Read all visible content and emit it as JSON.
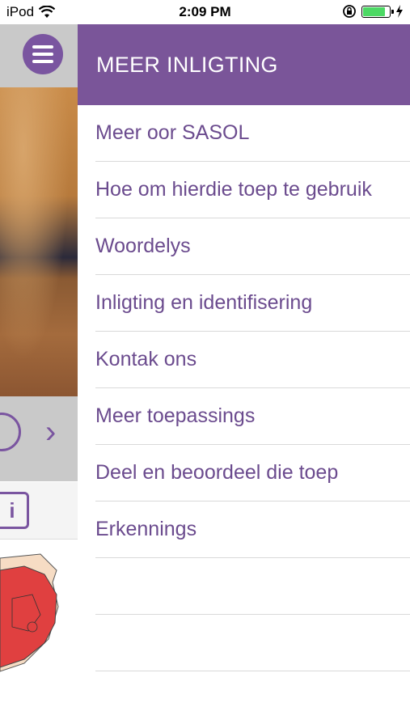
{
  "status_bar": {
    "device": "iPod",
    "time": "2:09 PM",
    "battery_level": 0.85
  },
  "background_app": {
    "nav_next_icon": "chevron-right-icon",
    "info_icon_label": "i"
  },
  "drawer": {
    "title": "MEER INLIGTING",
    "items": [
      {
        "label": "Meer oor SASOL"
      },
      {
        "label": "Hoe om hierdie toep te gebruik"
      },
      {
        "label": "Woordelys"
      },
      {
        "label": "Inligting en identifisering"
      },
      {
        "label": "Kontak ons"
      },
      {
        "label": "Meer toepassings"
      },
      {
        "label": "Deel en beoordeel die toep"
      },
      {
        "label": "Erkennings"
      },
      {
        "label": ""
      },
      {
        "label": ""
      }
    ]
  },
  "colors": {
    "accent": "#7a5599",
    "item_text": "#6b4b8e",
    "battery": "#4cd964"
  }
}
